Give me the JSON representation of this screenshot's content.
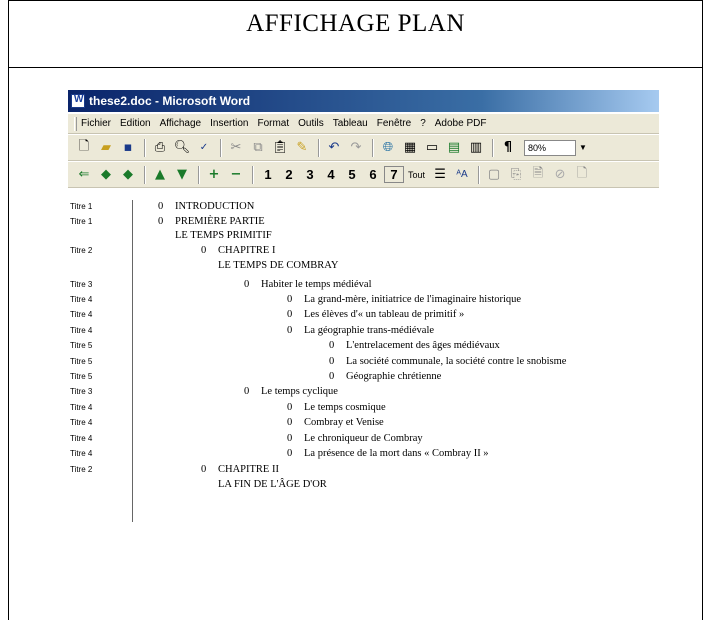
{
  "page": {
    "title": "AFFICHAGE PLAN"
  },
  "window": {
    "title": "these2.doc - Microsoft Word",
    "menus": [
      "Fichier",
      "Edition",
      "Affichage",
      "Insertion",
      "Format",
      "Outils",
      "Tableau",
      "Fenêtre",
      "?",
      "Adobe PDF"
    ],
    "zoom": "80%"
  },
  "toolbar2": {
    "levels": [
      "1",
      "2",
      "3",
      "4",
      "5",
      "6",
      "7"
    ],
    "all_label": "Tout"
  },
  "outline": [
    {
      "style": "Titre 1",
      "bullet": "0",
      "text": "INTRODUCTION"
    },
    {
      "style": "Titre 1",
      "bullet": "0",
      "text": "PREMIÈRE PARTIE"
    },
    {
      "style": "",
      "bullet": "",
      "text": "LE TEMPS PRIMITIF"
    },
    {
      "style": "Titre 2",
      "bullet": "0",
      "text": "CHAPITRE I"
    },
    {
      "style": "",
      "bullet": "",
      "text": "LE TEMPS DE COMBRAY"
    },
    {
      "style": "Titre 3",
      "bullet": "0",
      "text": "Habiter le temps médiéval"
    },
    {
      "style": "Titre 4",
      "bullet": "0",
      "text": "La grand-mère, initiatrice de l'imaginaire historique"
    },
    {
      "style": "Titre 4",
      "bullet": "0",
      "text": "Les élèves d'« un tableau de primitif »"
    },
    {
      "style": "Titre 4",
      "bullet": "0",
      "text": "La géographie trans-médiévale"
    },
    {
      "style": "Titre 5",
      "bullet": "0",
      "text": "L'entrelacement des âges médiévaux"
    },
    {
      "style": "Titre 5",
      "bullet": "0",
      "text": "La société communale, la société contre le snobisme"
    },
    {
      "style": "Titre 5",
      "bullet": "0",
      "text": "Géographie chrétienne"
    },
    {
      "style": "Titre 3",
      "bullet": "0",
      "text": "Le temps cyclique"
    },
    {
      "style": "Titre 4",
      "bullet": "0",
      "text": "Le temps cosmique"
    },
    {
      "style": "Titre 4",
      "bullet": "0",
      "text": "Combray et Venise"
    },
    {
      "style": "Titre 4",
      "bullet": "0",
      "text": "Le chroniqueur de Combray"
    },
    {
      "style": "Titre 4",
      "bullet": "0",
      "text": "La présence de la mort dans « Combray II »"
    },
    {
      "style": "Titre 2",
      "bullet": "0",
      "text": "CHAPITRE II"
    },
    {
      "style": "",
      "bullet": "",
      "text": "LA FIN DE L'ÂGE D'OR"
    }
  ],
  "colors": {
    "titlebar": "#0a246a",
    "chrome": "#ece9d8",
    "spellcheck": "#cc0000"
  }
}
